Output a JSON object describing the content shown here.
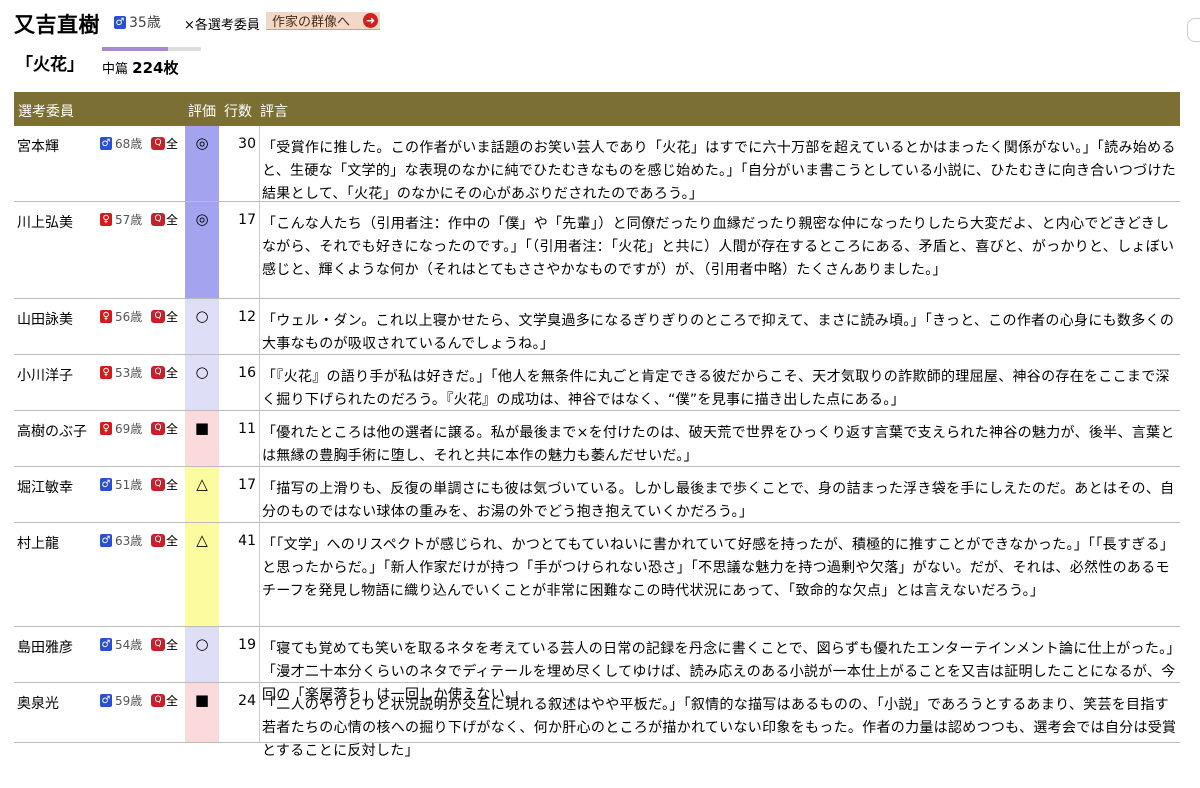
{
  "header": {
    "author": "又吉直樹",
    "age": "35歳",
    "gender_symbol": "♂",
    "role": "×各選考委員",
    "portrait_link": "作家の群像へ"
  },
  "work": {
    "title": "「火花」",
    "length_label": "中篇",
    "pages": "224枚",
    "progress_fraction": 0.67
  },
  "table": {
    "headers": {
      "committee": "選考委員",
      "rating": "評価",
      "lines": "行数",
      "comment": "評言"
    },
    "all_label": "全",
    "rows": [
      {
        "name": "宮本輝",
        "gender": "male",
        "gender_symbol": "♂",
        "age": "68歳",
        "mark": "◎",
        "lines": "30",
        "color": "#a3a3f0",
        "comment": "「受賞作に推した。この作者がいま話題のお笑い芸人であり「火花」はすでに六十万部を超えているとかはまったく関係がない。」「読み始めると、生硬な「文学的」な表現のなかに純でひたむきなものを感じ始めた。」「自分がいま書こうとしている小説に、ひたむきに向き合いつづけた結果として、「火花」のなかにその心があぶりだされたのであろう。」"
      },
      {
        "name": "川上弘美",
        "gender": "female",
        "gender_symbol": "♀",
        "age": "57歳",
        "mark": "◎",
        "lines": "17",
        "color": "#a3a3f0",
        "comment": "「こんな人たち（引用者注：作中の「僕」や「先輩」）と同僚だったり血縁だったり親密な仲になったりしたら大変だよ、と内心でどきどきしながら、それでも好きになったのです。」「（引用者注：「火花」と共に）人間が存在するところにある、矛盾と、喜びと、がっかりと、しょぼい感じと、輝くような何か（それはとてもささやかなものですが）が、（引用者中略）たくさんありました。」"
      },
      {
        "name": "山田詠美",
        "gender": "female",
        "gender_symbol": "♀",
        "age": "56歳",
        "mark": "○",
        "lines": "12",
        "color": "#dedef7",
        "comment": "「ウェル・ダン。これ以上寝かせたら、文学臭過多になるぎりぎりのところで抑えて、まさに読み頃。」「きっと、この作者の心身にも数多くの大事なものが吸収されているんでしょうね。」"
      },
      {
        "name": "小川洋子",
        "gender": "female",
        "gender_symbol": "♀",
        "age": "53歳",
        "mark": "○",
        "lines": "16",
        "color": "#dedef7",
        "comment": "「『火花』の語り手が私は好きだ。」「他人を無条件に丸ごと肯定できる彼だからこそ、天才気取りの詐欺師的理屈屋、神谷の存在をここまで深く掘り下げられたのだろう。『火花』の成功は、神谷ではなく、“僕”を見事に描き出した点にある。」"
      },
      {
        "name": "高樹のぶ子",
        "gender": "female",
        "gender_symbol": "♀",
        "age": "69歳",
        "mark": "■",
        "lines": "11",
        "color": "#fadada",
        "comment": "「優れたところは他の選者に譲る。私が最後まで×を付けたのは、破天荒で世界をひっくり返す言葉で支えられた神谷の魅力が、後半、言葉とは無縁の豊胸手術に堕し、それと共に本作の魅力も萎んだせいだ。」"
      },
      {
        "name": "堀江敏幸",
        "gender": "male",
        "gender_symbol": "♂",
        "age": "51歳",
        "mark": "△",
        "lines": "17",
        "color": "#fbfb9f",
        "comment": "「描写の上滑りも、反復の単調さにも彼は気づいている。しかし最後まで歩くことで、身の詰まった浮き袋を手にしえたのだ。あとはその、自分のものではない球体の重みを、お湯の外でどう抱き抱えていくかだろう。」"
      },
      {
        "name": "村上龍",
        "gender": "male",
        "gender_symbol": "♂",
        "age": "63歳",
        "mark": "△",
        "lines": "41",
        "color": "#fbfb9f",
        "comment": "「「文学」へのリスペクトが感じられ、かつとてもていねいに書かれていて好感を持ったが、積極的に推すことができなかった。」「「長すぎる」と思ったからだ。」「新人作家だけが持つ「手がつけられない恐さ」「不思議な魅力を持つ過剰や欠落」がない。だが、それは、必然性のあるモチーフを発見し物語に織り込んでいくことが非常に困難なこの時代状況にあって、「致命的な欠点」とは言えないだろう。」"
      },
      {
        "name": "島田雅彦",
        "gender": "male",
        "gender_symbol": "♂",
        "age": "54歳",
        "mark": "○",
        "lines": "19",
        "color": "#dedef7",
        "comment": "「寝ても覚めても笑いを取るネタを考えている芸人の日常の記録を丹念に書くことで、図らずも優れたエンターテインメント論に仕上がった。」「漫才二十本分くらいのネタでディテールを埋め尽くしてゆけば、読み応えのある小説が一本仕上がることを又吉は証明したことになるが、今回の「楽屋落ち」は一回しか使えない。」"
      },
      {
        "name": "奥泉光",
        "gender": "male",
        "gender_symbol": "♂",
        "age": "59歳",
        "mark": "■",
        "lines": "24",
        "color": "#fadada",
        "comment": "「二人のやりとりと状況説明が交互に現れる叙述はやや平板だ。」「叙情的な描写はあるものの、「小説」であろうとするあまり、笑芸を目指す若者たちの心情の核への掘り下げがなく、何か肝心のところが描かれていない印象をもった。作者の力量は認めつつも、選考会では自分は受賞とすることに反対した」"
      }
    ]
  }
}
